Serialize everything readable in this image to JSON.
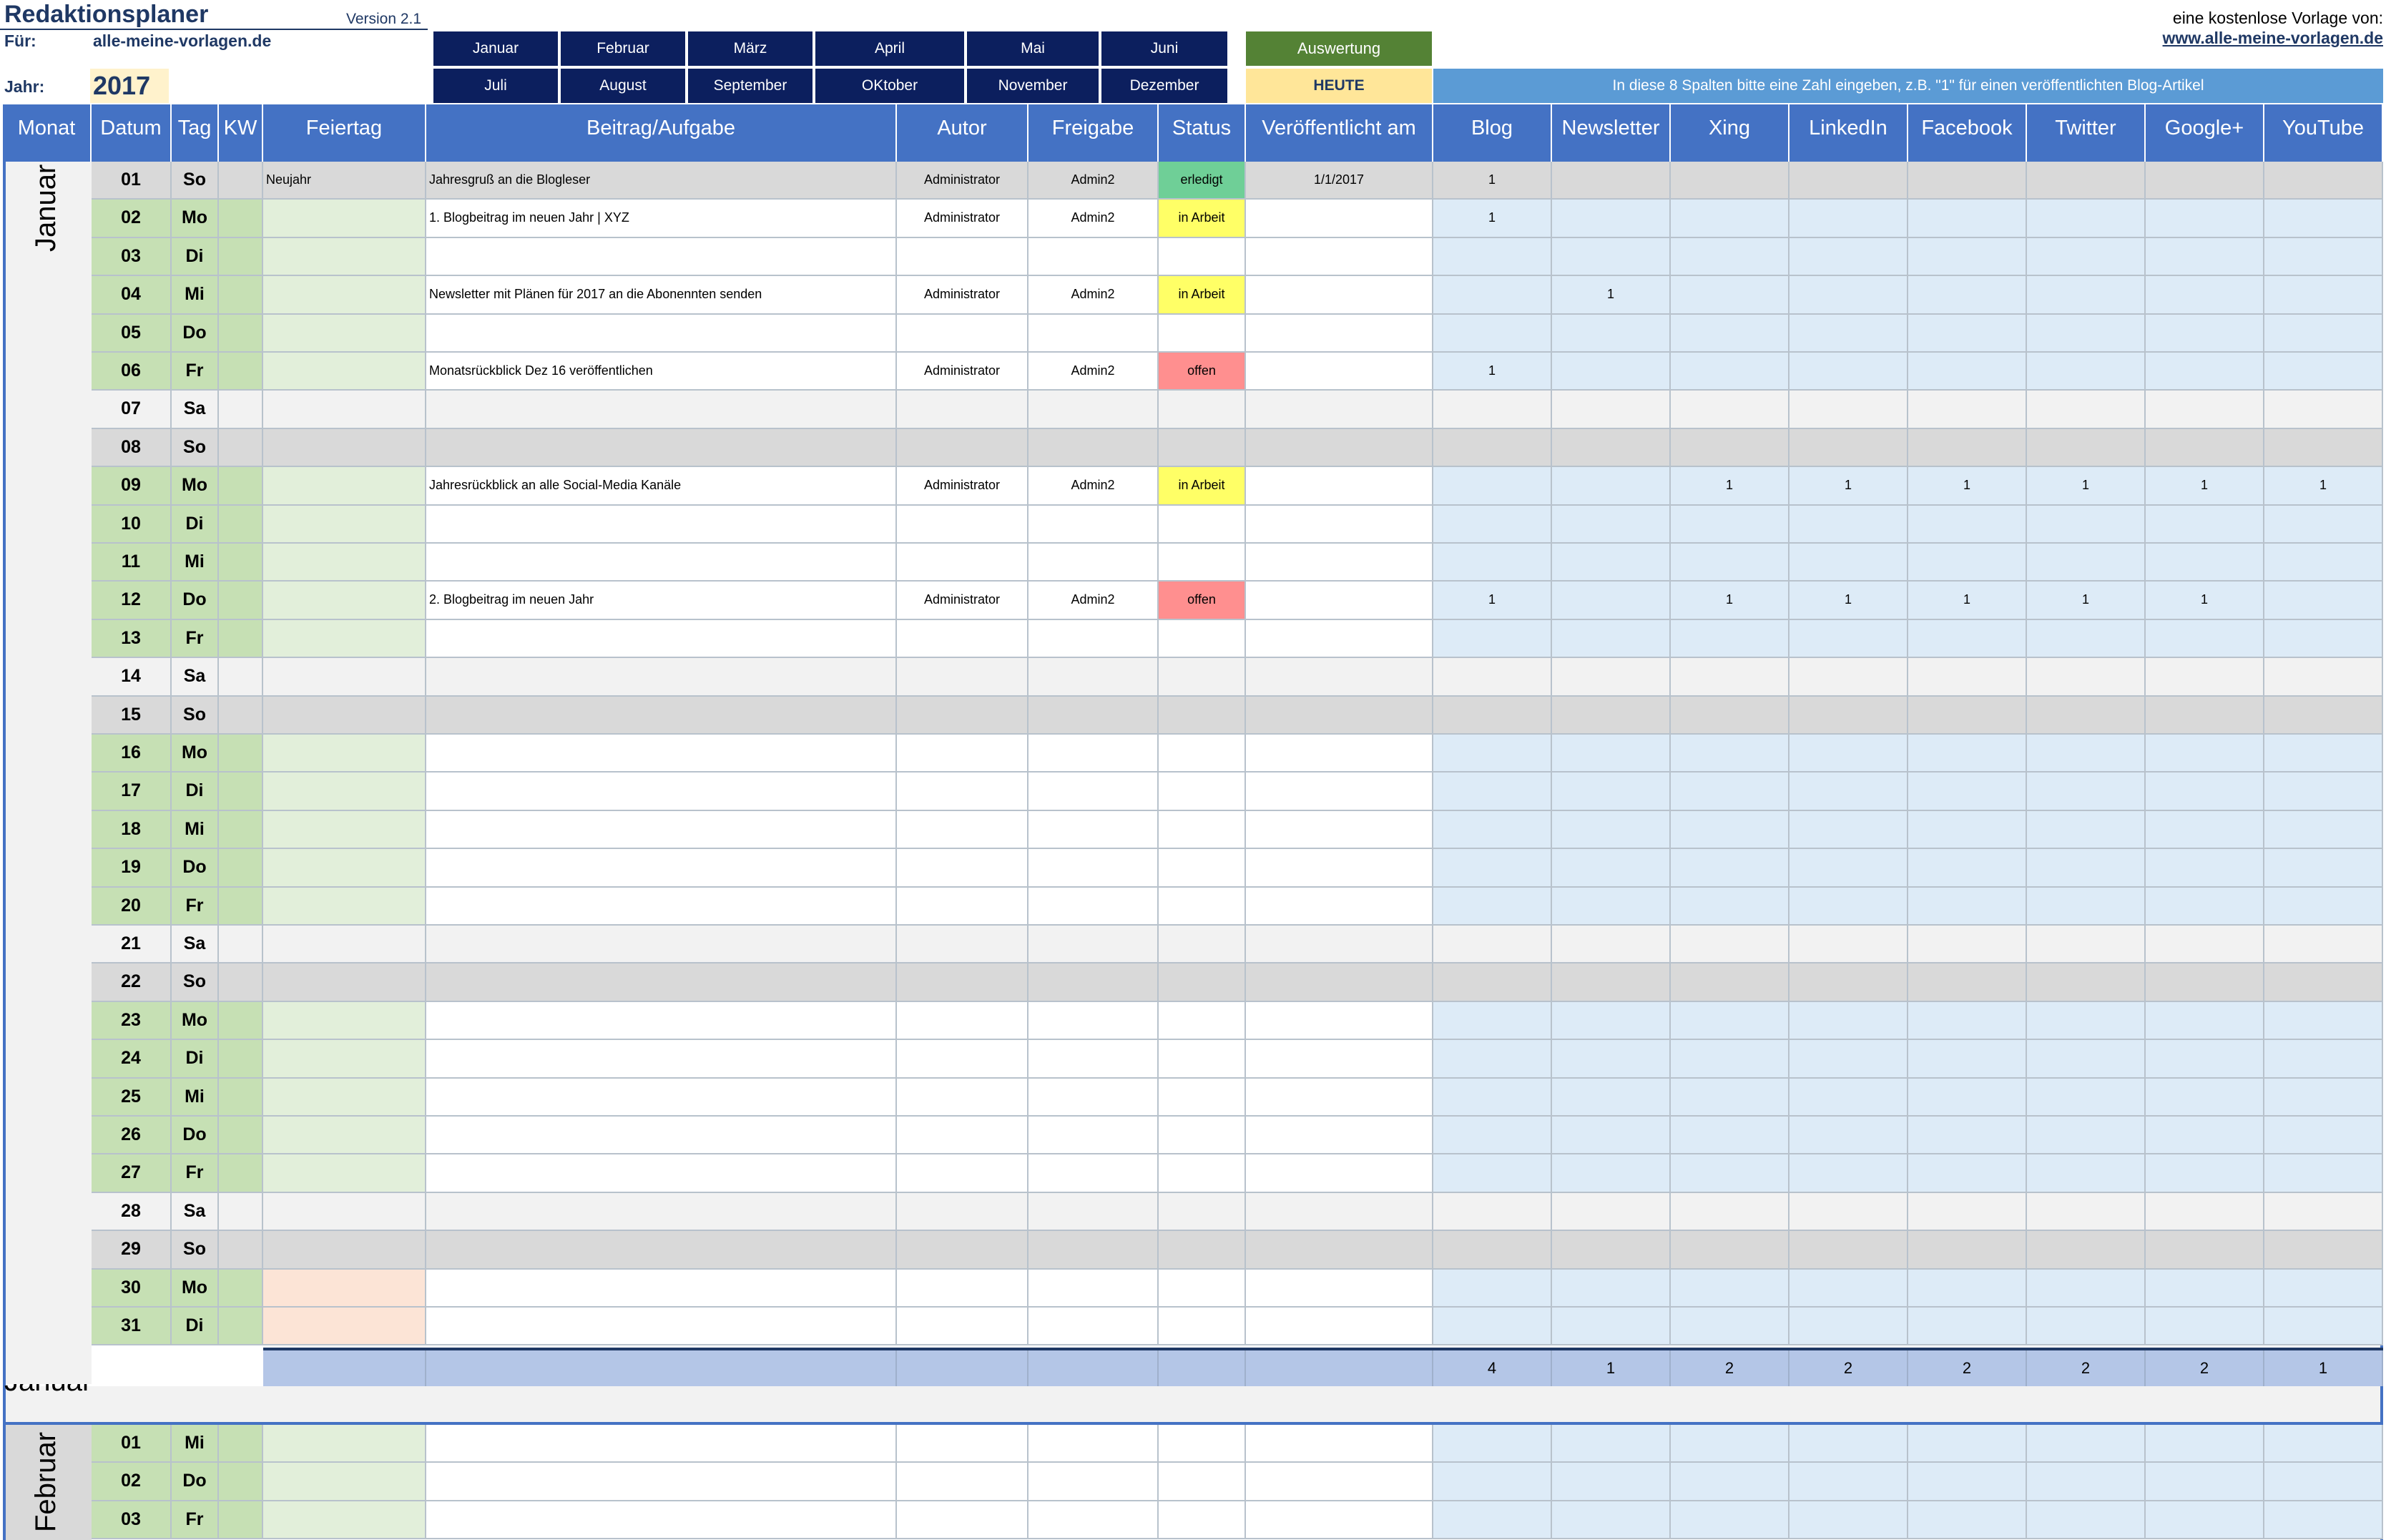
{
  "app": {
    "title": "Redaktionsplaner",
    "version": "Version 2.1",
    "fuer_label": "Für:",
    "fuer_value": "alle-meine-vorlagen.de",
    "jahr_label": "Jahr:",
    "jahr_value": "2017",
    "credit_text": "eine kostenlose Vorlage von:",
    "credit_link": "www.alle-meine-vorlagen.de"
  },
  "month_nav": {
    "row1": [
      "Januar",
      "Februar",
      "März",
      "April",
      "Mai",
      "Juni"
    ],
    "row2": [
      "Juli",
      "August",
      "September",
      "OKtober",
      "November",
      "Dezember"
    ]
  },
  "buttons": {
    "auswertung": "Auswertung",
    "heute": "HEUTE"
  },
  "hint": "In diese 8 Spalten bitte eine Zahl eingeben, z.B. \"1\" für einen veröffentlichten Blog-Artikel",
  "columns": [
    "Monat",
    "Datum",
    "Tag",
    "KW",
    "Feiertag",
    "Beitrag/Aufgabe",
    "Autor",
    "Freigabe",
    "Status",
    "Veröffentlicht am",
    "Blog",
    "Newsletter",
    "Xing",
    "LinkedIn",
    "Facebook",
    "Twitter",
    "Google+",
    "YouTube"
  ],
  "colors": {
    "header_blue": "#4472c4",
    "nav_navy": "#0c1f5e",
    "auswertung_green": "#548235",
    "heute_yellow": "#ffe699",
    "hint_blue": "#5b9bd5",
    "weekday_green": "#c6e0b4",
    "weekday_light_green": "#e2efda",
    "saturday_gray": "#f2f2f2",
    "sunday_gray": "#d9d9d9",
    "channel_blue": "#ddebf7",
    "holiday_peach": "#fce4d6",
    "status_erledigt": "#6fcf97",
    "status_in_arbeit": "#ffff66",
    "status_offen": "#ff8f8f",
    "sum_blue": "#b4c6e7"
  },
  "january": {
    "month_label": "Januar",
    "rows": [
      {
        "datum": "01",
        "tag": "So",
        "feiertag": "Neujahr",
        "beitrag": "Jahresgruß an die Blogleser",
        "autor": "Administrator",
        "freigabe": "Admin2",
        "status": "erledigt",
        "veroeffentlicht": "1/1/2017",
        "channels": [
          "1",
          "",
          "",
          "",
          "",
          "",
          "",
          ""
        ]
      },
      {
        "datum": "02",
        "tag": "Mo",
        "feiertag": "",
        "beitrag": "1. Blogbeitrag im neuen Jahr | XYZ",
        "autor": "Administrator",
        "freigabe": "Admin2",
        "status": "in Arbeit",
        "veroeffentlicht": "",
        "channels": [
          "1",
          "",
          "",
          "",
          "",
          "",
          "",
          ""
        ]
      },
      {
        "datum": "03",
        "tag": "Di",
        "feiertag": "",
        "beitrag": "",
        "autor": "",
        "freigabe": "",
        "status": "",
        "veroeffentlicht": "",
        "channels": [
          "",
          "",
          "",
          "",
          "",
          "",
          "",
          ""
        ]
      },
      {
        "datum": "04",
        "tag": "Mi",
        "feiertag": "",
        "beitrag": "Newsletter mit Plänen für 2017 an die Abonennten senden",
        "autor": "Administrator",
        "freigabe": "Admin2",
        "status": "in Arbeit",
        "veroeffentlicht": "",
        "channels": [
          "",
          "1",
          "",
          "",
          "",
          "",
          "",
          ""
        ]
      },
      {
        "datum": "05",
        "tag": "Do",
        "feiertag": "",
        "beitrag": "",
        "autor": "",
        "freigabe": "",
        "status": "",
        "veroeffentlicht": "",
        "channels": [
          "",
          "",
          "",
          "",
          "",
          "",
          "",
          ""
        ]
      },
      {
        "datum": "06",
        "tag": "Fr",
        "feiertag": "",
        "beitrag": "Monatsrückblick Dez 16 veröffentlichen",
        "autor": "Administrator",
        "freigabe": "Admin2",
        "status": "offen",
        "veroeffentlicht": "",
        "channels": [
          "1",
          "",
          "",
          "",
          "",
          "",
          "",
          ""
        ]
      },
      {
        "datum": "07",
        "tag": "Sa",
        "feiertag": "",
        "beitrag": "",
        "autor": "",
        "freigabe": "",
        "status": "",
        "veroeffentlicht": "",
        "channels": [
          "",
          "",
          "",
          "",
          "",
          "",
          "",
          ""
        ]
      },
      {
        "datum": "08",
        "tag": "So",
        "feiertag": "",
        "beitrag": "",
        "autor": "",
        "freigabe": "",
        "status": "",
        "veroeffentlicht": "",
        "channels": [
          "",
          "",
          "",
          "",
          "",
          "",
          "",
          ""
        ]
      },
      {
        "datum": "09",
        "tag": "Mo",
        "feiertag": "",
        "beitrag": "Jahresrückblick an alle Social-Media Kanäle",
        "autor": "Administrator",
        "freigabe": "Admin2",
        "status": "in Arbeit",
        "veroeffentlicht": "",
        "channels": [
          "",
          "",
          "1",
          "1",
          "1",
          "1",
          "1",
          "1"
        ]
      },
      {
        "datum": "10",
        "tag": "Di",
        "feiertag": "",
        "beitrag": "",
        "autor": "",
        "freigabe": "",
        "status": "",
        "veroeffentlicht": "",
        "channels": [
          "",
          "",
          "",
          "",
          "",
          "",
          "",
          ""
        ]
      },
      {
        "datum": "11",
        "tag": "Mi",
        "feiertag": "",
        "beitrag": "",
        "autor": "",
        "freigabe": "",
        "status": "",
        "veroeffentlicht": "",
        "channels": [
          "",
          "",
          "",
          "",
          "",
          "",
          "",
          ""
        ]
      },
      {
        "datum": "12",
        "tag": "Do",
        "feiertag": "",
        "beitrag": "2. Blogbeitrag im neuen Jahr",
        "autor": "Administrator",
        "freigabe": "Admin2",
        "status": "offen",
        "veroeffentlicht": "",
        "channels": [
          "1",
          "",
          "1",
          "1",
          "1",
          "1",
          "1",
          ""
        ]
      },
      {
        "datum": "13",
        "tag": "Fr",
        "feiertag": "",
        "beitrag": "",
        "autor": "",
        "freigabe": "",
        "status": "",
        "veroeffentlicht": "",
        "channels": [
          "",
          "",
          "",
          "",
          "",
          "",
          "",
          ""
        ]
      },
      {
        "datum": "14",
        "tag": "Sa",
        "feiertag": "",
        "beitrag": "",
        "autor": "",
        "freigabe": "",
        "status": "",
        "veroeffentlicht": "",
        "channels": [
          "",
          "",
          "",
          "",
          "",
          "",
          "",
          ""
        ]
      },
      {
        "datum": "15",
        "tag": "So",
        "feiertag": "",
        "beitrag": "",
        "autor": "",
        "freigabe": "",
        "status": "",
        "veroeffentlicht": "",
        "channels": [
          "",
          "",
          "",
          "",
          "",
          "",
          "",
          ""
        ]
      },
      {
        "datum": "16",
        "tag": "Mo",
        "feiertag": "",
        "beitrag": "",
        "autor": "",
        "freigabe": "",
        "status": "",
        "veroeffentlicht": "",
        "channels": [
          "",
          "",
          "",
          "",
          "",
          "",
          "",
          ""
        ]
      },
      {
        "datum": "17",
        "tag": "Di",
        "feiertag": "",
        "beitrag": "",
        "autor": "",
        "freigabe": "",
        "status": "",
        "veroeffentlicht": "",
        "channels": [
          "",
          "",
          "",
          "",
          "",
          "",
          "",
          ""
        ]
      },
      {
        "datum": "18",
        "tag": "Mi",
        "feiertag": "",
        "beitrag": "",
        "autor": "",
        "freigabe": "",
        "status": "",
        "veroeffentlicht": "",
        "channels": [
          "",
          "",
          "",
          "",
          "",
          "",
          "",
          ""
        ]
      },
      {
        "datum": "19",
        "tag": "Do",
        "feiertag": "",
        "beitrag": "",
        "autor": "",
        "freigabe": "",
        "status": "",
        "veroeffentlicht": "",
        "channels": [
          "",
          "",
          "",
          "",
          "",
          "",
          "",
          ""
        ]
      },
      {
        "datum": "20",
        "tag": "Fr",
        "feiertag": "",
        "beitrag": "",
        "autor": "",
        "freigabe": "",
        "status": "",
        "veroeffentlicht": "",
        "channels": [
          "",
          "",
          "",
          "",
          "",
          "",
          "",
          ""
        ]
      },
      {
        "datum": "21",
        "tag": "Sa",
        "feiertag": "",
        "beitrag": "",
        "autor": "",
        "freigabe": "",
        "status": "",
        "veroeffentlicht": "",
        "channels": [
          "",
          "",
          "",
          "",
          "",
          "",
          "",
          ""
        ]
      },
      {
        "datum": "22",
        "tag": "So",
        "feiertag": "",
        "beitrag": "",
        "autor": "",
        "freigabe": "",
        "status": "",
        "veroeffentlicht": "",
        "channels": [
          "",
          "",
          "",
          "",
          "",
          "",
          "",
          ""
        ]
      },
      {
        "datum": "23",
        "tag": "Mo",
        "feiertag": "",
        "beitrag": "",
        "autor": "",
        "freigabe": "",
        "status": "",
        "veroeffentlicht": "",
        "channels": [
          "",
          "",
          "",
          "",
          "",
          "",
          "",
          ""
        ]
      },
      {
        "datum": "24",
        "tag": "Di",
        "feiertag": "",
        "beitrag": "",
        "autor": "",
        "freigabe": "",
        "status": "",
        "veroeffentlicht": "",
        "channels": [
          "",
          "",
          "",
          "",
          "",
          "",
          "",
          ""
        ]
      },
      {
        "datum": "25",
        "tag": "Mi",
        "feiertag": "",
        "beitrag": "",
        "autor": "",
        "freigabe": "",
        "status": "",
        "veroeffentlicht": "",
        "channels": [
          "",
          "",
          "",
          "",
          "",
          "",
          "",
          ""
        ]
      },
      {
        "datum": "26",
        "tag": "Do",
        "feiertag": "",
        "beitrag": "",
        "autor": "",
        "freigabe": "",
        "status": "",
        "veroeffentlicht": "",
        "channels": [
          "",
          "",
          "",
          "",
          "",
          "",
          "",
          ""
        ]
      },
      {
        "datum": "27",
        "tag": "Fr",
        "feiertag": "",
        "beitrag": "",
        "autor": "",
        "freigabe": "",
        "status": "",
        "veroeffentlicht": "",
        "channels": [
          "",
          "",
          "",
          "",
          "",
          "",
          "",
          ""
        ]
      },
      {
        "datum": "28",
        "tag": "Sa",
        "feiertag": "",
        "beitrag": "",
        "autor": "",
        "freigabe": "",
        "status": "",
        "veroeffentlicht": "",
        "channels": [
          "",
          "",
          "",
          "",
          "",
          "",
          "",
          ""
        ]
      },
      {
        "datum": "29",
        "tag": "So",
        "feiertag": "",
        "beitrag": "",
        "autor": "",
        "freigabe": "",
        "status": "",
        "veroeffentlicht": "",
        "channels": [
          "",
          "",
          "",
          "",
          "",
          "",
          "",
          ""
        ]
      },
      {
        "datum": "30",
        "tag": "Mo",
        "feiertag": "",
        "beitrag": "",
        "autor": "",
        "freigabe": "",
        "status": "",
        "veroeffentlicht": "",
        "channels": [
          "",
          "",
          "",
          "",
          "",
          "",
          "",
          ""
        ]
      },
      {
        "datum": "31",
        "tag": "Di",
        "feiertag": "",
        "beitrag": "",
        "autor": "",
        "freigabe": "",
        "status": "",
        "veroeffentlicht": "",
        "channels": [
          "",
          "",
          "",
          "",
          "",
          "",
          "",
          ""
        ]
      }
    ],
    "sums": [
      "4",
      "1",
      "2",
      "2",
      "2",
      "2",
      "2",
      "1"
    ]
  },
  "february": {
    "month_label": "Februar",
    "rows": [
      {
        "datum": "01",
        "tag": "Mi"
      },
      {
        "datum": "02",
        "tag": "Do"
      },
      {
        "datum": "03",
        "tag": "Fr"
      }
    ]
  }
}
